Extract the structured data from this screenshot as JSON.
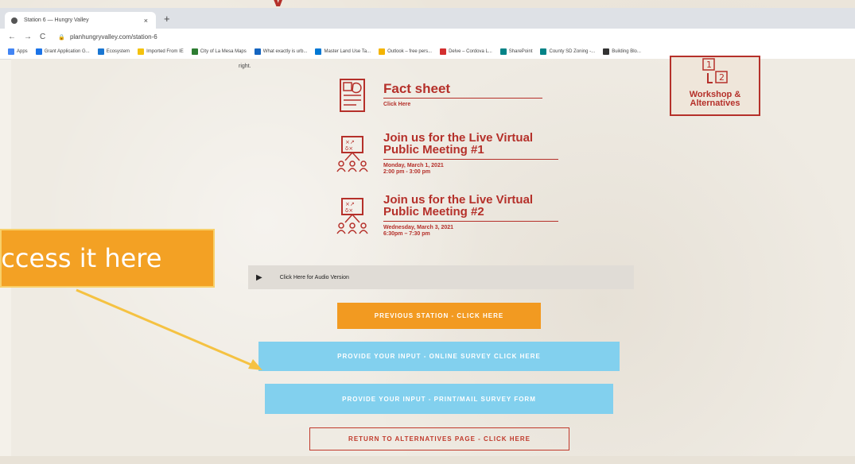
{
  "slide": {
    "title_fragment": "y",
    "callout_text": "Access it here"
  },
  "browser": {
    "tab_title": "Station 6 — Hungry Valley",
    "tab_close": "×",
    "new_tab": "+",
    "url": "planhungryvalley.com/station-6",
    "bookmarks": [
      {
        "label": "Apps",
        "color": "#4285f4"
      },
      {
        "label": "Grant Application G...",
        "color": "#1a73e8"
      },
      {
        "label": "Ecosystem",
        "color": "#1976d2"
      },
      {
        "label": "Imported From IE",
        "color": "#f4c20d"
      },
      {
        "label": "City of La Mesa Maps",
        "color": "#2e7d32"
      },
      {
        "label": "What exactly is urb...",
        "color": "#1565c0"
      },
      {
        "label": "Master Land Use Ta...",
        "color": "#0078d4"
      },
      {
        "label": "Outlook – free pers...",
        "color": "#f4b400"
      },
      {
        "label": "Delve – Cordova L...",
        "color": "#d32f2f"
      },
      {
        "label": "SharePoint",
        "color": "#038387"
      },
      {
        "label": "County SD Zoning -...",
        "color": "#038387"
      },
      {
        "label": "Building Blo...",
        "color": "#333333"
      }
    ]
  },
  "page": {
    "right_text": "right.",
    "fact_sheet": {
      "title": "Fact sheet",
      "link": "Click Here"
    },
    "meeting1": {
      "title_line1": "Join us for the Live Virtual",
      "title_line2": "Public Meeting #1",
      "date": "Monday, March 1, 2021",
      "time": "2:00 pm - 3:00 pm"
    },
    "meeting2": {
      "title_line1": "Join us for the Live Virtual",
      "title_line2": "Public Meeting #2",
      "date": "Wednesday, March 3, 2021",
      "time": "6:30pm – 7:30 pm"
    },
    "workshop": {
      "line1": "Workshop &",
      "line2": "Alternatives",
      "num1": "1",
      "num2": "2"
    },
    "audio_label": "Click Here for Audio Version",
    "btn_previous": "PREVIOUS STATION - CLICK HERE",
    "btn_online": "PROVIDE YOUR INPUT - ONLINE SURVEY CLICK HERE",
    "btn_print": "PROVIDE YOUR INPUT - PRINT/MAIL SURVEY FORM",
    "btn_return": "RETURN TO ALTERNATIVES PAGE - CLICK HERE"
  },
  "colors": {
    "accent_red": "#b5302a",
    "orange": "#f29a21",
    "blue": "#82d0ee",
    "callout": "#f3a124"
  }
}
